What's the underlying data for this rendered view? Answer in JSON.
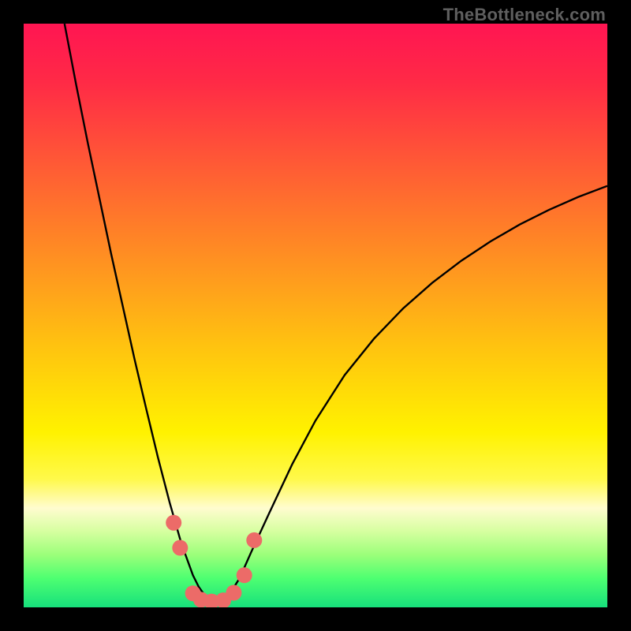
{
  "watermark": "TheBottleneck.com",
  "chart_data": {
    "type": "line",
    "title": "",
    "xlabel": "",
    "ylabel": "",
    "xlim": [
      0,
      1
    ],
    "ylim": [
      0,
      1
    ],
    "legend": false,
    "grid": false,
    "background_gradient_stops": [
      {
        "offset": 0.0,
        "color": "#ff1552"
      },
      {
        "offset": 0.1,
        "color": "#ff2a46"
      },
      {
        "offset": 0.25,
        "color": "#ff5d34"
      },
      {
        "offset": 0.4,
        "color": "#ff8f22"
      },
      {
        "offset": 0.55,
        "color": "#ffc210"
      },
      {
        "offset": 0.7,
        "color": "#fff200"
      },
      {
        "offset": 0.78,
        "color": "#fff94a"
      },
      {
        "offset": 0.83,
        "color": "#fffccf"
      },
      {
        "offset": 0.87,
        "color": "#d6ffa0"
      },
      {
        "offset": 0.91,
        "color": "#9bff7a"
      },
      {
        "offset": 0.95,
        "color": "#4eff71"
      },
      {
        "offset": 1.0,
        "color": "#17e07c"
      }
    ],
    "series": [
      {
        "name": "bottleneck-curve",
        "stroke": "#000000",
        "stroke_width": 2.4,
        "x": [
          0.07,
          0.09,
          0.11,
          0.13,
          0.15,
          0.17,
          0.19,
          0.21,
          0.23,
          0.25,
          0.27,
          0.29,
          0.3,
          0.31,
          0.32,
          0.33,
          0.34,
          0.35,
          0.37,
          0.39,
          0.42,
          0.46,
          0.5,
          0.55,
          0.6,
          0.65,
          0.7,
          0.75,
          0.8,
          0.85,
          0.9,
          0.95,
          1.0
        ],
        "y": [
          1.0,
          0.895,
          0.795,
          0.7,
          0.605,
          0.515,
          0.425,
          0.34,
          0.257,
          0.18,
          0.11,
          0.055,
          0.035,
          0.021,
          0.012,
          0.008,
          0.01,
          0.018,
          0.05,
          0.095,
          0.16,
          0.245,
          0.32,
          0.398,
          0.46,
          0.512,
          0.556,
          0.594,
          0.627,
          0.656,
          0.681,
          0.703,
          0.722
        ]
      }
    ],
    "markers": {
      "name": "highlighted-points",
      "color": "#ec6b68",
      "radius": 10,
      "points": [
        {
          "x": 0.257,
          "y": 0.145
        },
        {
          "x": 0.268,
          "y": 0.102
        },
        {
          "x": 0.29,
          "y": 0.024
        },
        {
          "x": 0.304,
          "y": 0.013
        },
        {
          "x": 0.322,
          "y": 0.01
        },
        {
          "x": 0.342,
          "y": 0.012
        },
        {
          "x": 0.36,
          "y": 0.025
        },
        {
          "x": 0.378,
          "y": 0.055
        },
        {
          "x": 0.395,
          "y": 0.115
        }
      ]
    }
  }
}
